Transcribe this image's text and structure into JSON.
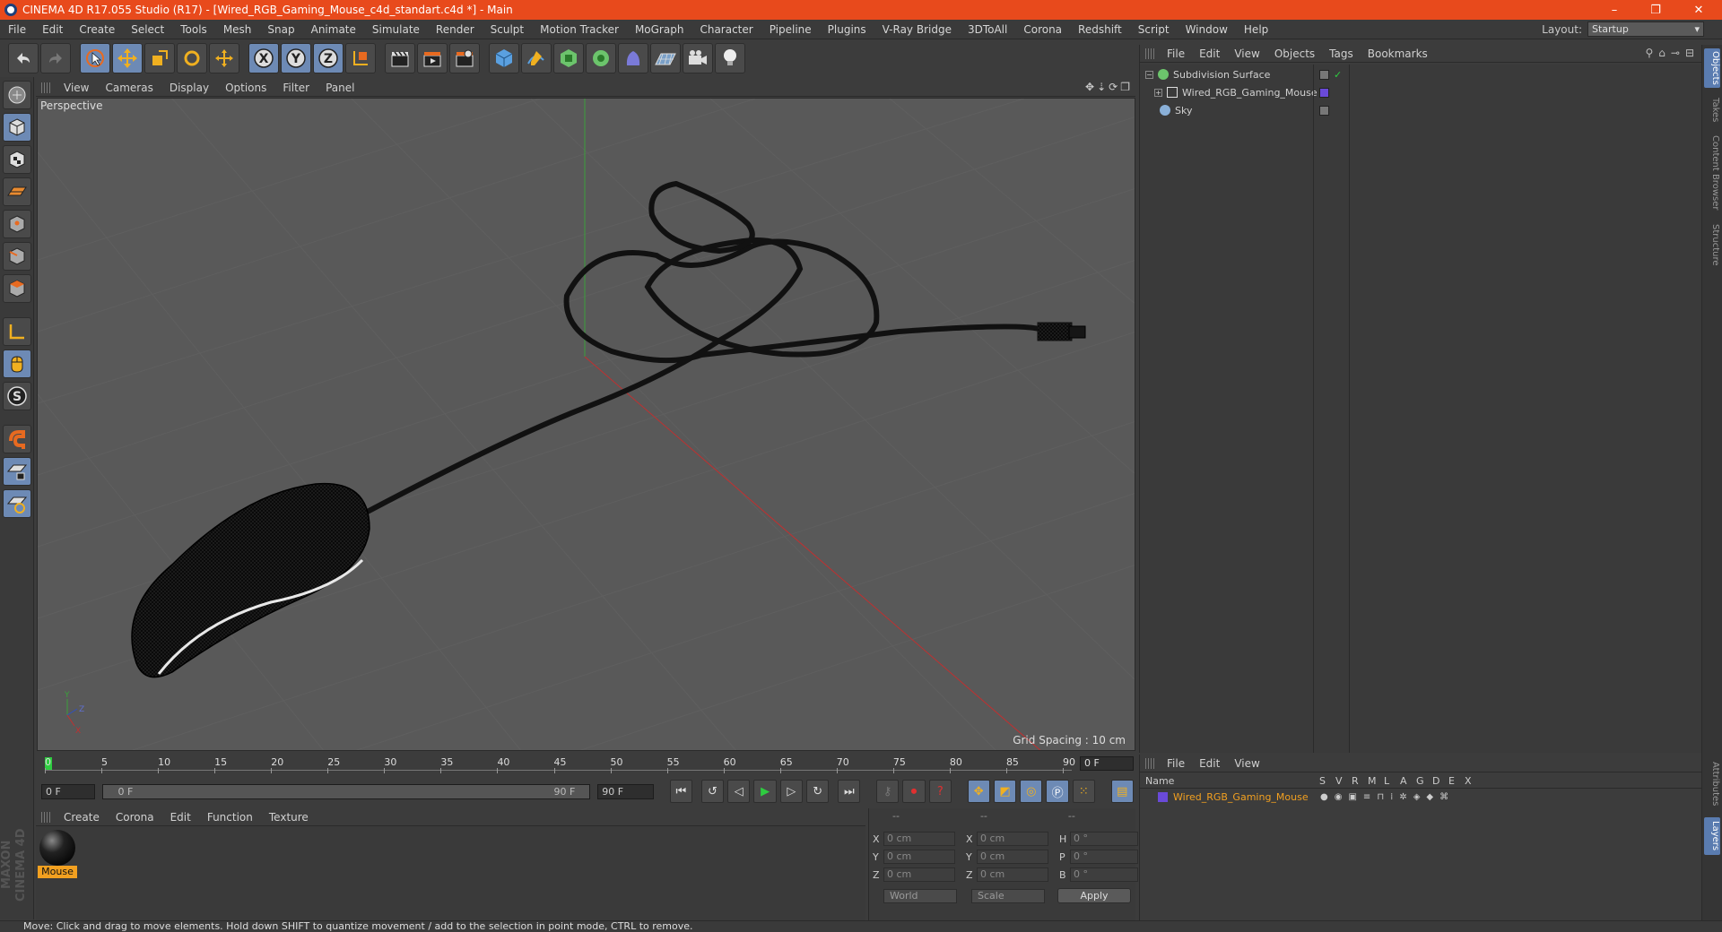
{
  "window": {
    "title": "CINEMA 4D R17.055 Studio (R17) - [Wired_RGB_Gaming_Mouse_c4d_standart.c4d *] - Main",
    "minimize": "–",
    "restore": "❐",
    "close": "✕"
  },
  "menu": [
    "File",
    "Edit",
    "Create",
    "Select",
    "Tools",
    "Mesh",
    "Snap",
    "Animate",
    "Simulate",
    "Render",
    "Sculpt",
    "Motion Tracker",
    "MoGraph",
    "Character",
    "Pipeline",
    "Plugins",
    "V-Ray Bridge",
    "3DToAll",
    "Corona",
    "Redshift",
    "Script",
    "Window",
    "Help"
  ],
  "layout": {
    "label": "Layout:",
    "value": "Startup"
  },
  "viewport": {
    "menu": [
      "View",
      "Cameras",
      "Display",
      "Options",
      "Filter",
      "Panel"
    ],
    "label": "Perspective",
    "grid_spacing": "Grid Spacing : 10 cm",
    "axis_y": "Y",
    "axis_z": "Z",
    "axis_x": "X"
  },
  "timeline": {
    "ticks": [
      "0",
      "5",
      "10",
      "15",
      "20",
      "25",
      "30",
      "35",
      "40",
      "45",
      "50",
      "55",
      "60",
      "65",
      "70",
      "75",
      "80",
      "85",
      "90"
    ],
    "current_frame": "0 F"
  },
  "playback": {
    "start": "0 F",
    "range_start": "0 F",
    "range_end": "90 F",
    "end": "90 F"
  },
  "material_manager": {
    "menu": [
      "Create",
      "Corona",
      "Edit",
      "Function",
      "Texture"
    ],
    "material_name": "Mouse"
  },
  "coordinates": {
    "header": [
      "--",
      "--",
      "--"
    ],
    "rows": [
      {
        "a": "X",
        "av": "0 cm",
        "b": "X",
        "bv": "0 cm",
        "c": "H",
        "cv": "0 °"
      },
      {
        "a": "Y",
        "av": "0 cm",
        "b": "Y",
        "bv": "0 cm",
        "c": "P",
        "cv": "0 °"
      },
      {
        "a": "Z",
        "av": "0 cm",
        "b": "Z",
        "bv": "0 cm",
        "c": "B",
        "cv": "0 °"
      }
    ],
    "space": "World",
    "mode": "Scale",
    "apply": "Apply"
  },
  "object_manager": {
    "menu": [
      "File",
      "Edit",
      "View",
      "Objects",
      "Tags",
      "Bookmarks"
    ],
    "objects": [
      {
        "name": "Subdivision Surface",
        "color": "#6cc46c"
      },
      {
        "name": "Wired_RGB_Gaming_Mouse",
        "color": "#6a4ad8"
      },
      {
        "name": "Sky",
        "color": "#8ab0d8"
      }
    ]
  },
  "layer_manager": {
    "menu": [
      "File",
      "Edit",
      "View"
    ],
    "columns": [
      "Name",
      "S",
      "V",
      "R",
      "M",
      "L",
      "A",
      "G",
      "D",
      "E",
      "X"
    ],
    "layer_name": "Wired_RGB_Gaming_Mouse"
  },
  "right_tabs": [
    "Objects",
    "Takes",
    "Content Browser",
    "Structure",
    "Attributes",
    "Layers"
  ],
  "brand": "MAXON CINEMA 4D",
  "status": "Move: Click and drag to move elements. Hold down SHIFT to quantize movement / add to the selection in point mode, CTRL to remove.",
  "colors": {
    "titlebar": "#e84a1c",
    "accent": "#6d8ab5",
    "material_label": "#f2a020"
  }
}
